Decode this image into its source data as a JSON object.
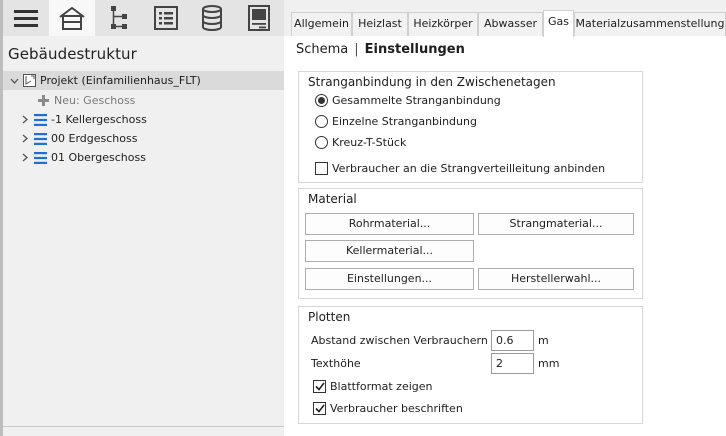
{
  "toolbar": {
    "items": [
      {
        "name": "hamburger-menu-icon"
      },
      {
        "name": "building-icon",
        "active": true
      },
      {
        "name": "network-tree-icon"
      },
      {
        "name": "list-document-icon"
      },
      {
        "name": "database-icon"
      },
      {
        "name": "sheet-icon"
      }
    ]
  },
  "tree": {
    "title": "Gebäudestruktur",
    "project": "Projekt (Einfamilienhaus_FLT)",
    "new_floor": "Neu: Geschoss",
    "floors": [
      "-1 Kellergeschoss",
      "00 Erdgeschoss",
      "01 Obergeschoss"
    ]
  },
  "tabs": [
    "Allgemein",
    "Heizlast",
    "Heizkörper",
    "Abwasser",
    "Gas",
    "Materialzusammenstellung"
  ],
  "active_tab": "Gas",
  "breadcrumb": {
    "schema": "Schema",
    "sep": "|",
    "settings": "Einstellungen"
  },
  "strang": {
    "title": "Stranganbindung in den Zwischenetagen",
    "options": [
      "Gesammelte Stranganbindung",
      "Einzelne Stranganbindung",
      "Kreuz-T-Stück"
    ],
    "selected_index": 0,
    "checkbox_label": "Verbraucher an die Strangverteilleitung anbinden",
    "checkbox_checked": false
  },
  "material": {
    "title": "Material",
    "rohr": "Rohrmaterial...",
    "strang": "Strangmaterial...",
    "keller": "Kellermaterial...",
    "einstellungen": "Einstellungen...",
    "hersteller": "Herstellerwahl..."
  },
  "plotten": {
    "title": "Plotten",
    "abstand_label": "Abstand zwischen Verbrauchern",
    "abstand_value": "0.6",
    "abstand_unit": "m",
    "text_label": "Texthöhe",
    "text_value": "2",
    "text_unit": "mm",
    "blatt_label": "Blattformat zeigen",
    "blatt_checked": true,
    "beschriften_label": "Verbraucher beschriften",
    "beschriften_checked": true
  },
  "colors": {
    "accent_blue": "#1e6fd9",
    "selected_row": "#dadada"
  }
}
